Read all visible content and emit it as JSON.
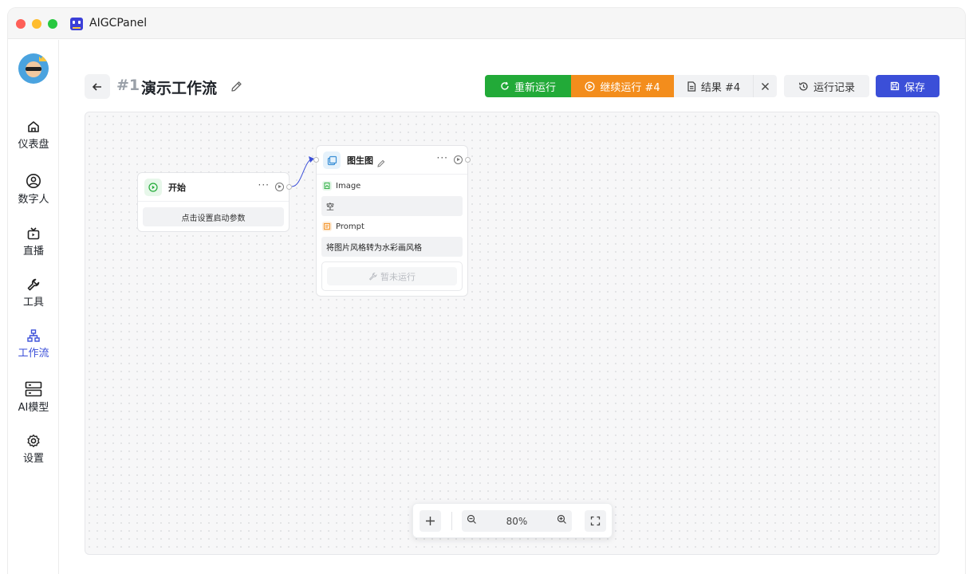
{
  "app": {
    "title": "AIGCPanel"
  },
  "sidebar": {
    "items": [
      {
        "label": "仪表盘",
        "icon": "home-icon"
      },
      {
        "label": "数字人",
        "icon": "user-circle-icon"
      },
      {
        "label": "直播",
        "icon": "tv-icon"
      },
      {
        "label": "工具",
        "icon": "wrench-icon"
      },
      {
        "label": "工作流",
        "icon": "workflow-icon",
        "active": true
      },
      {
        "label": "AI模型",
        "icon": "server-icon"
      },
      {
        "label": "设置",
        "icon": "gear-icon"
      }
    ]
  },
  "header": {
    "back_icon": "arrow-left-icon",
    "workflow_id": "#1",
    "workflow_name": "演示工作流",
    "buttons": {
      "rerun": "重新运行",
      "continue": "继续运行 #4",
      "result": "结果 #4",
      "history": "运行记录",
      "save": "保存"
    }
  },
  "nodes": {
    "start": {
      "title": "开始",
      "more": "···",
      "action": "点击设置启动参数"
    },
    "img2img": {
      "title": "图生图",
      "more": "···",
      "fields": [
        {
          "label": "Image",
          "value": "空"
        },
        {
          "label": "Prompt",
          "value": "将图片风格转为水彩画风格"
        }
      ],
      "status": "暂未运行"
    }
  },
  "zoom": {
    "level": "80%"
  },
  "colors": {
    "accent": "#3b4fd8",
    "rerun": "#22aa38",
    "continue": "#f38d1c",
    "connector": "#3b4fd8"
  }
}
